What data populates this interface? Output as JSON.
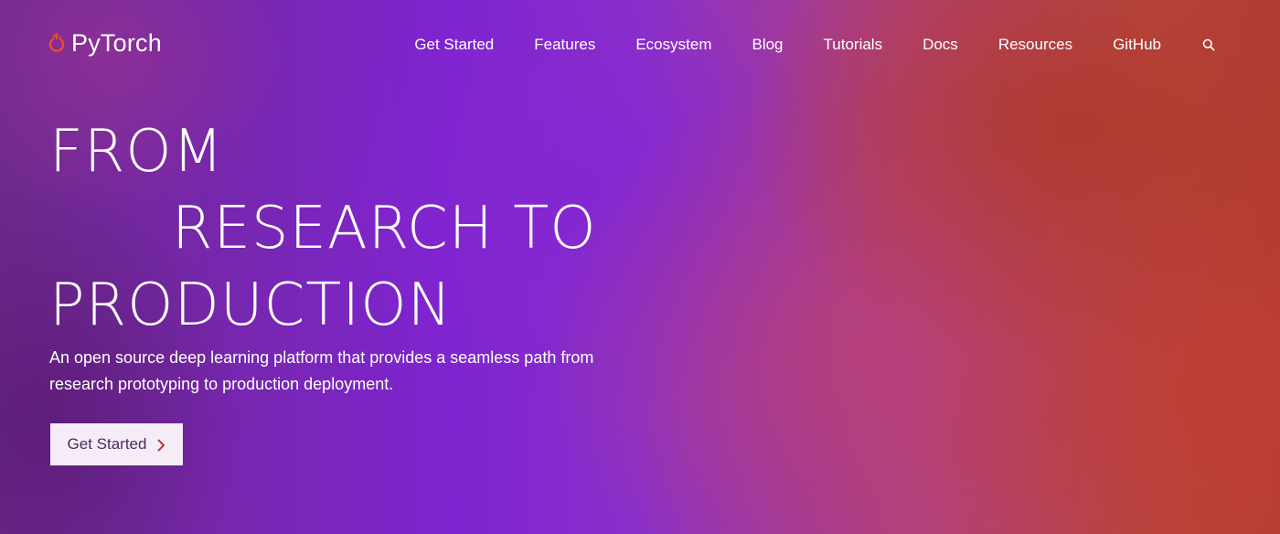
{
  "header": {
    "logo_text": "PyTorch",
    "logo_icon": "pytorch-flame-icon",
    "nav": [
      {
        "label": "Get Started"
      },
      {
        "label": "Features"
      },
      {
        "label": "Ecosystem"
      },
      {
        "label": "Blog"
      },
      {
        "label": "Tutorials"
      },
      {
        "label": "Docs"
      },
      {
        "label": "Resources"
      },
      {
        "label": "GitHub"
      }
    ],
    "search_icon": "search-icon"
  },
  "hero": {
    "headline_line1": "FROM",
    "headline_line2": "RESEARCH TO",
    "headline_line3": "PRODUCTION",
    "lead": "An open source deep learning platform that provides a seamless path from research prototyping to production deployment.",
    "cta_label": "Get Started",
    "cta_icon": "chevron-right-icon"
  },
  "colors": {
    "accent_logo": "#ee4c2c",
    "cta_background": "#f6ecf8",
    "cta_text": "#4a2c5a",
    "cta_chevron": "#c0392b"
  }
}
